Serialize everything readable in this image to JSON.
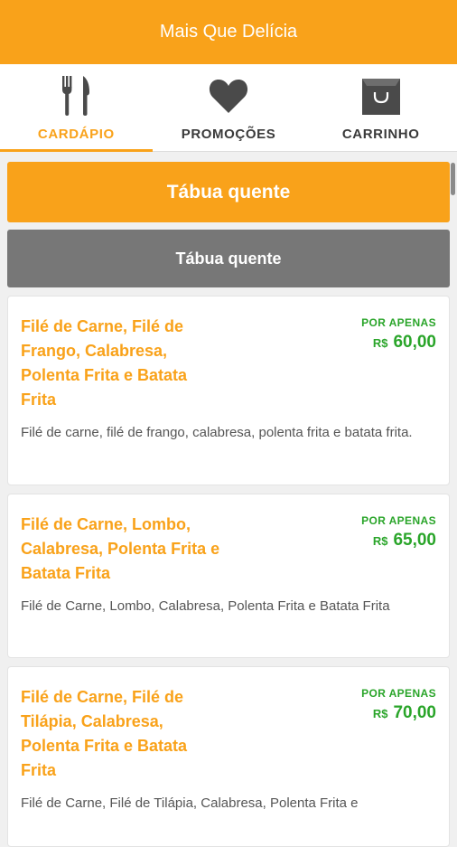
{
  "app": {
    "title": "Mais Que Delícia"
  },
  "tabs": [
    {
      "label": "CARDÁPIO",
      "icon": "fork-knife-icon",
      "active": true
    },
    {
      "label": "PROMOÇÕES",
      "icon": "heart-icon",
      "active": false
    },
    {
      "label": "CARRINHO",
      "icon": "shopping-bag-icon",
      "active": false
    }
  ],
  "category": {
    "title": "Tábua quente",
    "subtitle": "Tábua quente"
  },
  "items": [
    {
      "name": "Filé de Carne, Filé de Frango, Calabresa, Polenta Frita e Batata Frita",
      "price_label": "POR APENAS",
      "currency": "R$",
      "price": "60,00",
      "description": "Filé de carne, filé de frango, calabresa, polenta frita e batata frita."
    },
    {
      "name": "Filé de Carne, Lombo, Calabresa, Polenta Frita e Batata Frita",
      "price_label": "POR APENAS",
      "currency": "R$",
      "price": "65,00",
      "description": "Filé de Carne, Lombo, Calabresa, Polenta Frita e Batata Frita"
    },
    {
      "name": "Filé de Carne, Filé de Tilápia, Calabresa, Polenta Frita e Batata Frita",
      "price_label": "POR APENAS",
      "currency": "R$",
      "price": "70,00",
      "description": "Filé de Carne, Filé de Tilápia, Calabresa, Polenta Frita e"
    }
  ],
  "colors": {
    "accent": "#f9a21a",
    "price": "#2aa52a",
    "subheader": "#777777"
  }
}
